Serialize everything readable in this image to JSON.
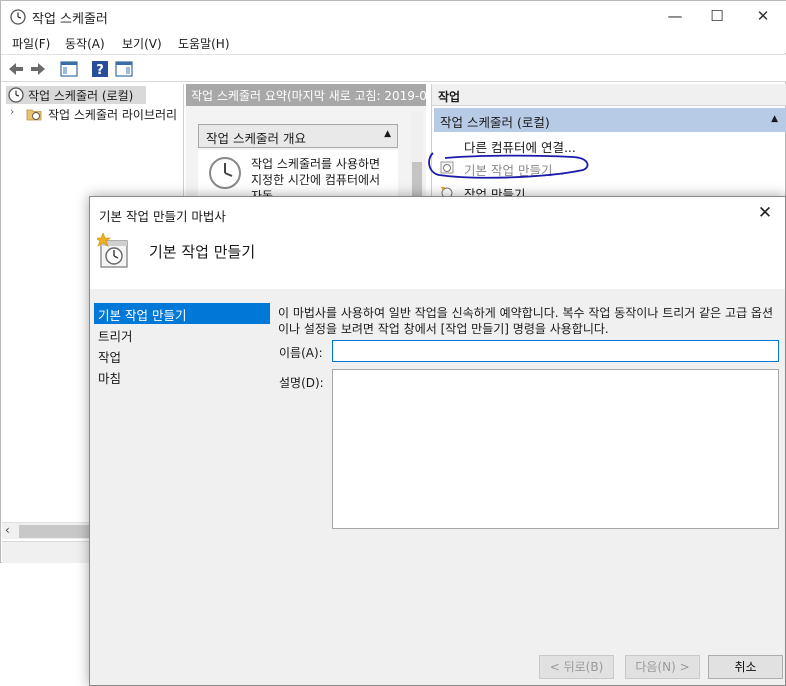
{
  "main_window": {
    "title": "작업 스케줄러",
    "controls": [
      "—",
      "☐",
      "✕"
    ]
  },
  "menubar": [
    "파일(F)",
    "동작(A)",
    "보기(V)",
    "도움말(H)"
  ],
  "tree": {
    "items": [
      "작업 스케줄러 (로컬)",
      "작업 스케줄러 라이브러리"
    ]
  },
  "center": {
    "header": "작업 스케줄러 요약(마지막 새로 고침: 2019-0",
    "overview_title": "작업 스케줄러 개요",
    "overview_text": "작업 스케줄러를 사용하면 지정한 시간에 컴퓨터에서 자동"
  },
  "actions": {
    "header": "작업",
    "section": "작업 스케줄러 (로컬)",
    "items": [
      "다른 컴퓨터에 연결...",
      "기본 작업 만들기...",
      "작업 만들기..."
    ]
  },
  "wizard": {
    "title": "기본 작업 만들기 마법사",
    "heading": "기본 작업 만들기",
    "steps": [
      "기본 작업 만들기",
      "트리거",
      "작업",
      "마침"
    ],
    "description": "이 마법사를 사용하여 일반 작업을 신속하게 예약합니다. 복수 작업 동작이나 트리거 같은 고급 옵션이나 설정을 보려면 작업 창에서 [작업 만들기] 명령을 사용합니다.",
    "name_label": "이름(A):",
    "name_value": "",
    "desc_label": "설명(D):",
    "desc_value": "",
    "buttons": {
      "back": "< 뒤로(B)",
      "next": "다음(N) >",
      "cancel": "취소"
    }
  }
}
